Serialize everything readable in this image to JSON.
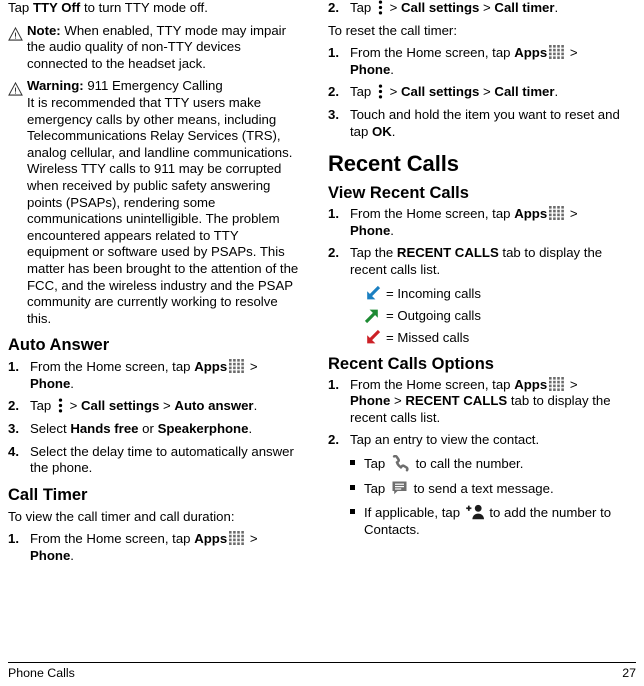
{
  "document": {
    "footer_left": "Phone Calls",
    "footer_page": "27"
  },
  "icons": {
    "apps": "apps-grid-icon",
    "kebab": "more-options-icon",
    "warning_triangle": "warning-triangle-icon",
    "incoming": "incoming-call-arrow-icon",
    "outgoing": "outgoing-call-arrow-icon",
    "missed": "missed-call-arrow-icon",
    "phone": "phone-handset-icon",
    "message": "message-bubble-icon",
    "add_contact": "add-contact-icon"
  },
  "colors": {
    "incoming": "#1a7fc1",
    "outgoing": "#1d8a33",
    "missed": "#cc2026",
    "icon_gray": "#6e6e6e",
    "text": "#000000"
  },
  "left_column": {
    "intro": {
      "pre": "Tap ",
      "bold": "TTY Off",
      "post": " to turn TTY mode off."
    },
    "note": {
      "label": "Note:",
      "text": " When enabled, TTY mode may impair the audio quality of non-TTY devices connected to the headset jack."
    },
    "warning": {
      "label": "Warning:",
      "title": " 911 Emergency Calling",
      "text": "It is recommended that TTY users make emergency calls by other means, including Telecommunications Relay Services (TRS), analog cellular, and landline communications. Wireless TTY calls to 911 may be corrupted when received by public safety answering points (PSAPs), rendering some communications unintelligible. The problem encountered appears related to TTY equipment or software used by PSAPs. This matter has been brought to the attention of the FCC, and the wireless industry and the PSAP community are currently working to resolve this."
    },
    "auto_answer": {
      "heading": "Auto Answer",
      "steps": [
        {
          "num": "1.",
          "pre": "From the Home screen, tap ",
          "bold1": "Apps",
          "mid": " > ",
          "bold2": "Phone",
          "post": "."
        },
        {
          "num": "2.",
          "pre": "Tap ",
          "mid": " > ",
          "bold1": "Call settings",
          "sep": " > ",
          "bold2": "Auto answer",
          "post": "."
        },
        {
          "num": "3.",
          "pre": "Select ",
          "bold1": "Hands free",
          "mid": " or ",
          "bold2": "Speakerphone",
          "post": "."
        },
        {
          "num": "4.",
          "text": "Select the delay time to automatically answer the phone."
        }
      ]
    },
    "call_timer": {
      "heading": "Call Timer",
      "intro": "To view the call timer and call duration:",
      "step1": {
        "num": "1.",
        "pre": "From the Home screen, tap ",
        "bold1": "Apps",
        "mid": " > ",
        "bold2": "Phone",
        "post": "."
      }
    }
  },
  "right_column": {
    "call_timer_step2": {
      "num": "2.",
      "pre": "Tap ",
      "mid": " > ",
      "bold1": "Call settings",
      "sep": " > ",
      "bold2": "Call timer",
      "post": "."
    },
    "reset_intro": "To reset the call timer:",
    "reset_steps": [
      {
        "num": "1.",
        "pre": "From the Home screen, tap ",
        "bold1": "Apps",
        "mid": " > ",
        "bold2": "Phone",
        "post": "."
      },
      {
        "num": "2.",
        "pre": "Tap ",
        "mid": " > ",
        "bold1": "Call settings",
        "sep": " > ",
        "bold2": "Call timer",
        "post": "."
      },
      {
        "num": "3.",
        "pre": "Touch and hold the item you want to reset and tap ",
        "bold1": "OK",
        "post": "."
      }
    ],
    "recent_calls": {
      "heading": "Recent Calls",
      "view_heading": "View Recent Calls",
      "view_steps": [
        {
          "num": "1.",
          "pre": "From the Home screen, tap ",
          "bold1": "Apps",
          "mid": " > ",
          "bold2": "Phone",
          "post": "."
        },
        {
          "num": "2.",
          "pre": "Tap the ",
          "bold1": "RECENT CALLS",
          "post": " tab to display the recent calls list."
        }
      ],
      "legend": [
        {
          "icon": "incoming-call-arrow-icon",
          "label": "= Incoming calls"
        },
        {
          "icon": "outgoing-call-arrow-icon",
          "label": "= Outgoing calls"
        },
        {
          "icon": "missed-call-arrow-icon",
          "label": "= Missed calls"
        }
      ],
      "options_heading": "Recent Calls Options",
      "options_steps": [
        {
          "num": "1.",
          "pre": "From the Home screen, tap ",
          "bold1": "Apps",
          "mid": " > ",
          "bold2": "Phone",
          "sep": " > ",
          "bold3": "RECENT CALLS",
          "post": " tab to display the recent calls list."
        },
        {
          "num": "2.",
          "text": "Tap an entry to view the contact."
        }
      ],
      "bullets": [
        {
          "pre": "Tap ",
          "post": " to call the number."
        },
        {
          "pre": "Tap ",
          "post": " to send a text message."
        },
        {
          "pre": "If applicable, tap ",
          "post": " to add the number to Contacts."
        }
      ]
    }
  }
}
